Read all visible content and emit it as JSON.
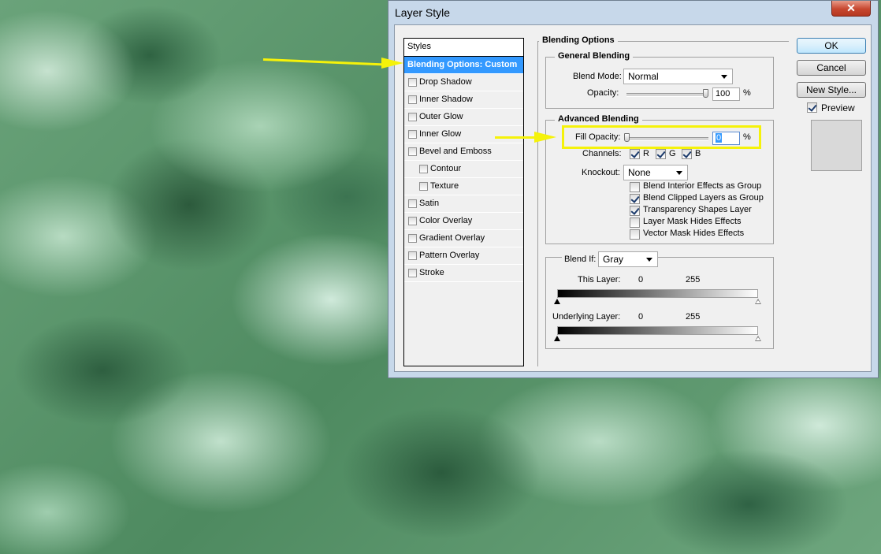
{
  "dialog": {
    "title": "Layer Style",
    "close_glyph": "✕"
  },
  "styles_list": {
    "header": "Styles",
    "selected": "Blending Options: Custom",
    "items": [
      {
        "label": "Drop Shadow",
        "checked": false
      },
      {
        "label": "Inner Shadow",
        "checked": false
      },
      {
        "label": "Outer Glow",
        "checked": false
      },
      {
        "label": "Inner Glow",
        "checked": false
      },
      {
        "label": "Bevel and Emboss",
        "checked": false
      },
      {
        "label": "Contour",
        "checked": false,
        "sub": true
      },
      {
        "label": "Texture",
        "checked": false,
        "sub": true
      },
      {
        "label": "Satin",
        "checked": false
      },
      {
        "label": "Color Overlay",
        "checked": false
      },
      {
        "label": "Gradient Overlay",
        "checked": false
      },
      {
        "label": "Pattern Overlay",
        "checked": false
      },
      {
        "label": "Stroke",
        "checked": false
      }
    ]
  },
  "blending_options": {
    "title": "Blending Options",
    "general": {
      "title": "General Blending",
      "blend_mode_label": "Blend Mode:",
      "blend_mode_value": "Normal",
      "opacity_label": "Opacity:",
      "opacity_value": "100",
      "opacity_level": 100,
      "percent": "%"
    },
    "advanced": {
      "title": "Advanced Blending",
      "fill_opacity_label": "Fill Opacity:",
      "fill_opacity_value": "0",
      "fill_opacity_level": 0,
      "percent": "%",
      "channels_label": "Channels:",
      "channel_r": "R",
      "channel_g": "G",
      "channel_b": "B",
      "knockout_label": "Knockout:",
      "knockout_value": "None",
      "options": [
        {
          "label": "Blend Interior Effects as Group",
          "checked": false
        },
        {
          "label": "Blend Clipped Layers as Group",
          "checked": true
        },
        {
          "label": "Transparency Shapes Layer",
          "checked": true
        },
        {
          "label": "Layer Mask Hides Effects",
          "checked": false
        },
        {
          "label": "Vector Mask Hides Effects",
          "checked": false
        }
      ]
    },
    "blend_if": {
      "label": "Blend If:",
      "value": "Gray",
      "this_layer_label": "This Layer:",
      "this_layer_low": "0",
      "this_layer_high": "255",
      "underlying_label": "Underlying Layer:",
      "underlying_low": "0",
      "underlying_high": "255"
    }
  },
  "buttons": {
    "ok": "OK",
    "cancel": "Cancel",
    "new_style": "New Style...",
    "preview_label": "Preview",
    "preview_checked": true
  },
  "colors": {
    "highlight": "#f5f20a",
    "selection": "#3399ff"
  }
}
